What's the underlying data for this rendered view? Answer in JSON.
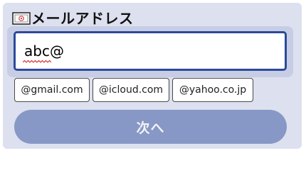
{
  "email_form": {
    "label_icon": "envelope-icon",
    "label": "メールアドレス",
    "input_value": "abc@",
    "domain_suggestions": [
      "@gmail.com",
      "@icloud.com",
      "@yahoo.co.jp"
    ],
    "next_label": "次へ"
  },
  "colors": {
    "panel_bg": "#dde0ee",
    "input_border": "#2b4a99",
    "input_halo": "#c7cde4",
    "next_button_bg": "#8798c6",
    "spellcheck_underline": "#d02020"
  }
}
